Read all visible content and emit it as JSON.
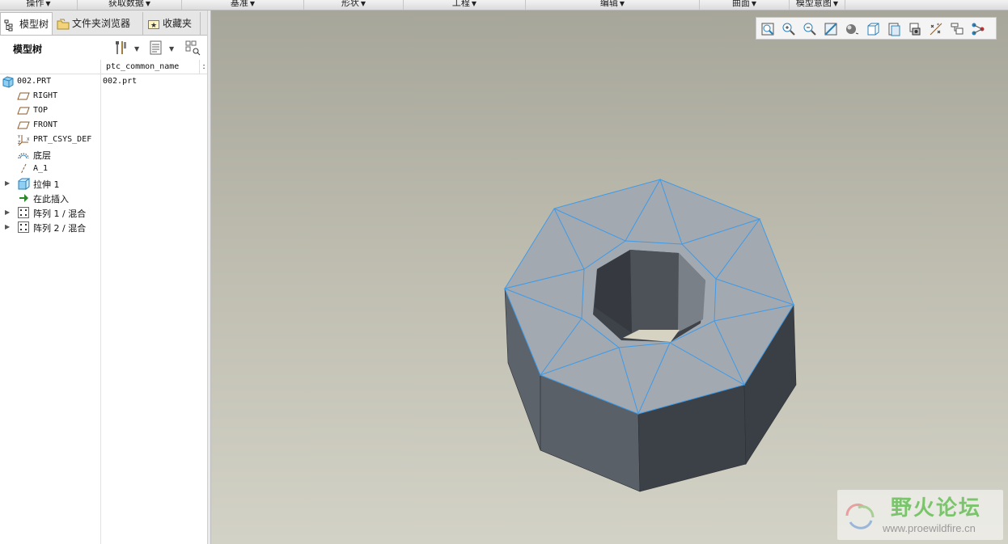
{
  "menu_groups": [
    {
      "label": "操作"
    },
    {
      "label": "获取数据"
    },
    {
      "label": "基准"
    },
    {
      "label": "形状"
    },
    {
      "label": "工程"
    },
    {
      "label": "编辑"
    },
    {
      "label": "曲面"
    },
    {
      "label": "模型意图"
    }
  ],
  "tabs": [
    {
      "label": "模型树",
      "active": true
    },
    {
      "label": "文件夹浏览器",
      "active": false
    },
    {
      "label": "收藏夹",
      "active": false
    }
  ],
  "model_tree": {
    "title": "模型树",
    "column_header": "ptc_common_name",
    "column_header_extra": ":",
    "rows": [
      {
        "label": "002.PRT",
        "icon": "part-icon",
        "value": "002.prt",
        "expandable": false
      },
      {
        "label": "RIGHT",
        "icon": "datum-plane-icon",
        "value": "",
        "expandable": false
      },
      {
        "label": "TOP",
        "icon": "datum-plane-icon",
        "value": "",
        "expandable": false
      },
      {
        "label": "FRONT",
        "icon": "datum-plane-icon",
        "value": "",
        "expandable": false
      },
      {
        "label": "PRT_CSYS_DEF",
        "icon": "csys-icon",
        "value": "",
        "expandable": false
      },
      {
        "label": "底层",
        "icon": "layer-icon",
        "value": "",
        "expandable": false
      },
      {
        "label": "A_1",
        "icon": "axis-icon",
        "value": "",
        "expandable": false
      },
      {
        "label": "拉伸 1",
        "icon": "extrude-icon",
        "value": "",
        "expandable": true
      },
      {
        "label": "在此插入",
        "icon": "insert-arrow-icon",
        "value": "",
        "expandable": false
      },
      {
        "label": "阵列 1 / 混合",
        "icon": "pattern-icon",
        "value": "",
        "expandable": true
      },
      {
        "label": "阵列 2 / 混合",
        "icon": "pattern-icon",
        "value": "",
        "expandable": true
      }
    ]
  },
  "view_toolbar": [
    "refit-icon",
    "zoom-in-icon",
    "zoom-out-icon",
    "repaint-icon",
    "display-style-icon",
    "saved-views-icon",
    "view-manager-icon",
    "perspective-icon",
    "datum-display-icon",
    "annotation-display-icon",
    "spin-center-icon"
  ],
  "watermark": {
    "title": "野火论坛",
    "url": "www.proewildfire.cn"
  },
  "colors": {
    "edge_highlight": "#3d9be9",
    "side_dark": "#3f444b",
    "top_face": "#a3a9b1"
  }
}
